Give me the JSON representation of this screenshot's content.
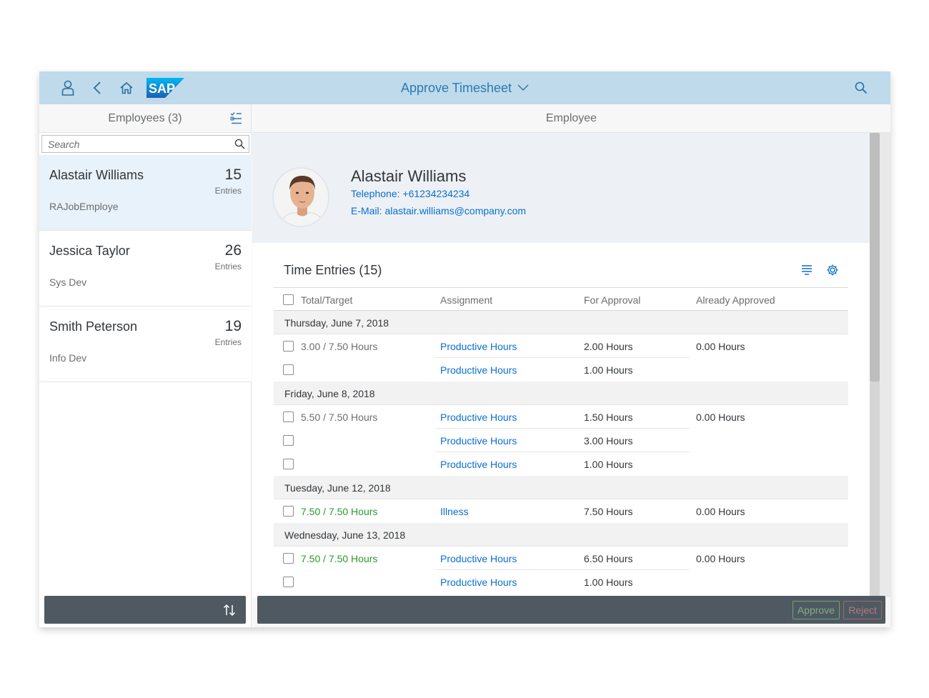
{
  "shell": {
    "title": "Approve Timesheet",
    "logo_text": "SAP"
  },
  "master": {
    "title": "Employees (3)",
    "search_placeholder": "Search",
    "employees": [
      {
        "name": "Alastair Williams",
        "count": "15",
        "unit": "Entries",
        "role": "RAJobEmploye"
      },
      {
        "name": "Jessica Taylor",
        "count": "26",
        "unit": "Entries",
        "role": "Sys Dev"
      },
      {
        "name": "Smith Peterson",
        "count": "19",
        "unit": "Entries",
        "role": "Info Dev"
      }
    ]
  },
  "detail": {
    "title": "Employee",
    "employee": {
      "name": "Alastair Williams",
      "telephone": "Telephone: +61234234234",
      "email": "E-Mail: alastair.williams@company.com"
    },
    "section_title": "Time Entries (15)",
    "columns": [
      "Total/Target",
      "Assignment",
      "For Approval",
      "Already Approved"
    ],
    "groups": [
      {
        "date": "Thursday, June 7, 2018",
        "rows": [
          {
            "total": "3.00 / 7.50 Hours",
            "assignment": "Productive Hours",
            "for_approval": "2.00 Hours",
            "approved": "0.00 Hours"
          },
          {
            "total": "",
            "assignment": "Productive Hours",
            "for_approval": "1.00 Hours",
            "approved": ""
          }
        ]
      },
      {
        "date": "Friday, June 8, 2018",
        "rows": [
          {
            "total": "5.50 / 7.50 Hours",
            "assignment": "Productive Hours",
            "for_approval": "1.50 Hours",
            "approved": "0.00 Hours"
          },
          {
            "total": "",
            "assignment": "Productive Hours",
            "for_approval": "3.00 Hours",
            "approved": ""
          },
          {
            "total": "",
            "assignment": "Productive Hours",
            "for_approval": "1.00 Hours",
            "approved": ""
          }
        ]
      },
      {
        "date": "Tuesday, June 12, 2018",
        "rows": [
          {
            "total": "7.50 / 7.50 Hours",
            "assignment": "Illness",
            "for_approval": "7.50 Hours",
            "approved": "0.00 Hours"
          }
        ]
      },
      {
        "date": "Wednesday, June 13, 2018",
        "rows": [
          {
            "total": "7.50 / 7.50 Hours",
            "assignment": "Productive Hours",
            "for_approval": "6.50 Hours",
            "approved": "0.00 Hours"
          },
          {
            "total": "",
            "assignment": "Productive Hours",
            "for_approval": "1.00 Hours",
            "approved": ""
          }
        ]
      }
    ],
    "actions": {
      "approve": "Approve",
      "reject": "Reject"
    }
  },
  "colors": {
    "shell_bg": "#bfdaea",
    "link": "#0a6ed1",
    "complete": "#2b9a2e",
    "footer": "#4f5962"
  }
}
